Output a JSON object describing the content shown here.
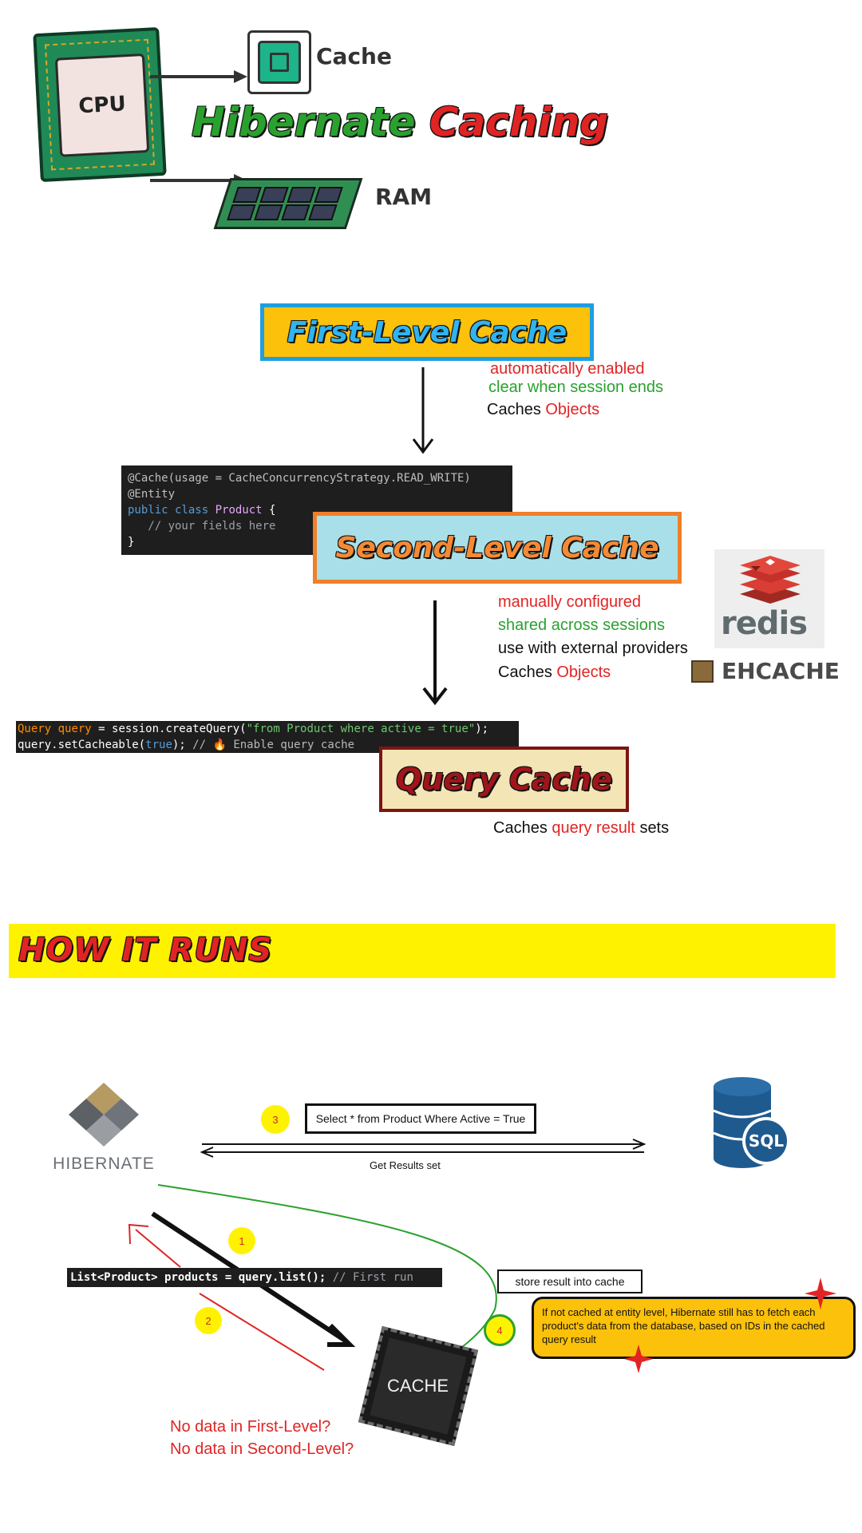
{
  "header": {
    "title_word1": "Hibernate",
    "title_word2": "Caching",
    "cpu_label": "CPU",
    "cache_label": "Cache",
    "ram_label": "RAM"
  },
  "first_level": {
    "title": "First-Level Cache",
    "notes": [
      "automatically enabled",
      "clear when session ends"
    ],
    "caches_prefix": "Caches",
    "caches_object": "Objects"
  },
  "entity_code": {
    "line1": "@Cache(usage = CacheConcurrencyStrategy.READ_WRITE)",
    "line2": "@Entity",
    "line3_kw": "public class",
    "line3_name": "Product",
    "line3_rest": " {",
    "line4": "   // your fields here",
    "line5": "}"
  },
  "second_level": {
    "title": "Second-Level Cache",
    "notes": [
      "manually configured",
      "shared across sessions",
      "use with external providers"
    ],
    "caches_prefix": "Caches",
    "caches_object": "Objects",
    "providers": [
      "redis",
      "EHCACHE"
    ]
  },
  "query_code": {
    "l1_type": "Query",
    "l1_var": " query",
    "l1_mid": " = session.createQuery(",
    "l1_str": "\"from Product where active = true\"",
    "l1_end": ");",
    "l2_start": "query.setCacheable(",
    "l2_kw": "true",
    "l2_end": "); ",
    "l2_comment": "// 🔥 Enable query cache"
  },
  "query_cache": {
    "title": "Query Cache",
    "caches_prefix": "Caches",
    "caches_highlight": "query result",
    "caches_suffix": "sets"
  },
  "how_it_runs": {
    "banner": "HOW IT RUNS",
    "hibernate_logo": "HIBERNATE",
    "sql_label": "SQL",
    "select_query": "Select * from Product Where Active = True",
    "get_results": "Get Results set",
    "list_code_main": "List<Product> products = query.list();",
    "list_code_comment": " // First run",
    "store_label": "store result into cache",
    "cache_chip": "CACHE",
    "steps": [
      "1",
      "2",
      "3",
      "4"
    ],
    "explanation": "If not cached at entity level, Hibernate still has to fetch each product's data from the database, based on IDs in the cached query result",
    "misses": [
      "No data in First-Level?",
      "No data in Second-Level?"
    ]
  },
  "colors": {
    "first_level_bg": "#fcc10a",
    "first_level_border": "#1f9ee0",
    "first_level_text": "#30b4f0",
    "second_level_bg": "#a9dfe8",
    "second_level_border": "#f07f2a",
    "second_level_text": "#f58a34",
    "query_bg": "#f3e5b5",
    "query_border": "#7e1414",
    "query_text": "#a0151a",
    "banner_bg": "#fff200",
    "red": "#e02424",
    "green": "#2aa12f",
    "redis_red": "#d93e34",
    "redis_gray": "#5f6b6e"
  }
}
